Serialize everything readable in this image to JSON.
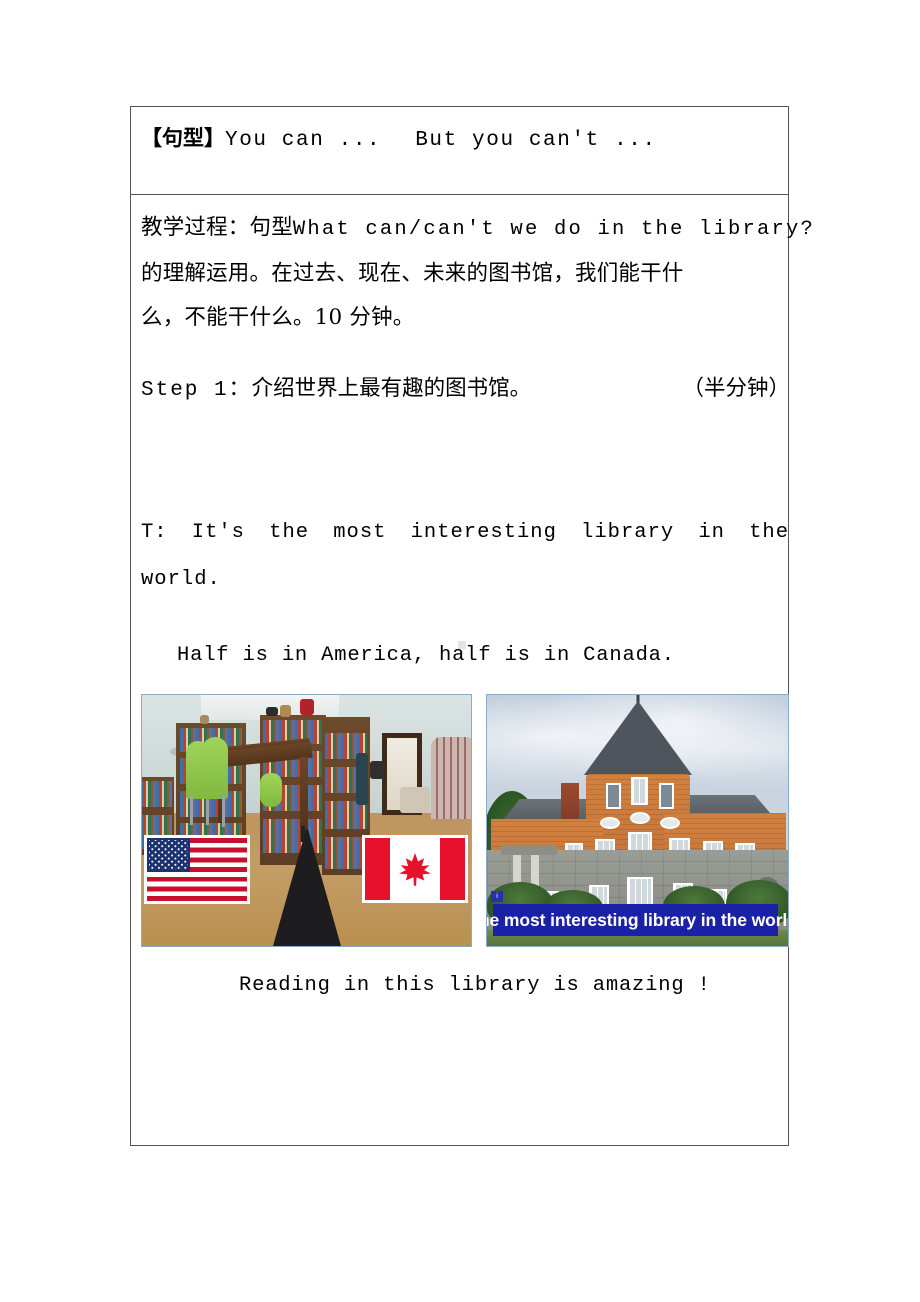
{
  "document": {
    "sentence_pattern_row": {
      "label_cn": "【句型】",
      "text_en_1": "You can ...",
      "text_en_2": "But you can't ..."
    },
    "body_row": {
      "teaching_process": {
        "prefix_cn": "教学过程：句型",
        "question_en": "What can/can't we do in the library?",
        "continuation_cn_line2": "的理解运用。在过去、现在、未来的图书馆，我们能干什",
        "continuation_cn_line3": "么，不能干什么。10 分钟。"
      },
      "step": {
        "label_en": "Step 1：",
        "label_cn": "介绍世界上最有趣的图书馆。",
        "duration_cn": "（半分钟）"
      },
      "teacher_line": {
        "speaker": "T:",
        "text_line1": "It's the most interesting library in the",
        "text_line2": "world."
      },
      "half_line": "Half is in America, half is in Canada.",
      "figures": [
        {
          "name": "library-interior-with-flags",
          "alt": "Library interior with a black border line on the floor, US flag on the left and Canadian flag on the right",
          "flag_left": "united-states-flag",
          "flag_right": "canada-flag"
        },
        {
          "name": "haskell-free-library-building",
          "alt": "Brick and stone library building with a pointed turret roof",
          "caption": "the most interesting library in the world",
          "caption_bg": "#1b21a6",
          "caption_color": "#ffffff"
        }
      ],
      "closing_line": "Reading in this library is amazing !"
    }
  },
  "colors": {
    "table_border": "#55565a",
    "figure_border": "#8aaac6",
    "caption_blue": "#1b21a6",
    "flag_red_usa": "#c8102e",
    "flag_blue_usa": "#1b3170",
    "flag_red_canada": "#e8112d",
    "page_background": "#ffffff",
    "text": "#000000"
  }
}
